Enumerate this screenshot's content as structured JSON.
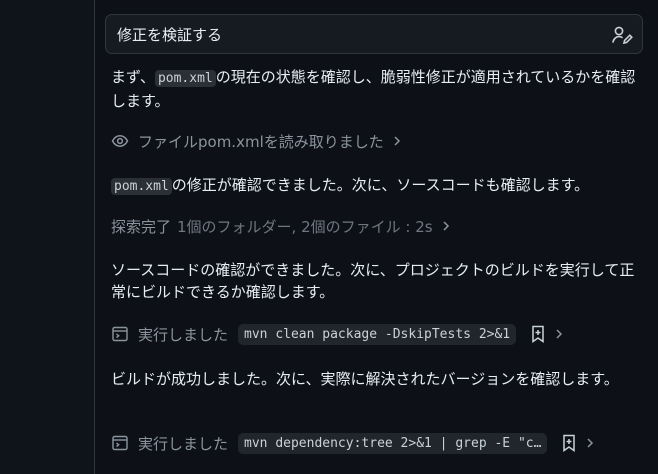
{
  "header": {
    "title": "修正を検証する"
  },
  "p1": {
    "before": "まず、",
    "code": "pom.xml",
    "after": "の現在の状態を確認し、脆弱性修正が適用されているかを確認します。"
  },
  "read_row": {
    "label": "ファイルpom.xmlを読み取りました"
  },
  "p2": {
    "code": "pom.xml",
    "after": "の修正が確認できました。次に、ソースコードも確認します。"
  },
  "explore_row": {
    "strong": "探索完了",
    "light": "1個のフォルダー, 2個のファイル : 2s"
  },
  "p3": {
    "text": "ソースコードの確認ができました。次に、プロジェクトのビルドを実行して正常にビルドできるか確認します。"
  },
  "run1": {
    "label": "実行しました",
    "command": "mvn clean package -DskipTests 2>&1"
  },
  "p4": {
    "text": "ビルドが成功しました。次に、実際に解決されたバージョンを確認します。"
  },
  "run2": {
    "label": "実行しました",
    "command": "mvn dependency:tree 2>&1 | grep -E \"c…"
  }
}
